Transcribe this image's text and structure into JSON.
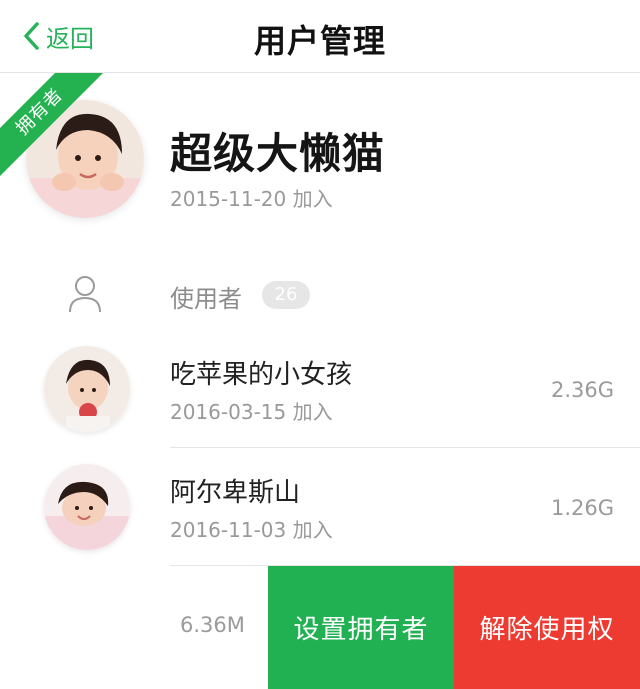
{
  "header": {
    "back_label": "返回",
    "title": "用户管理"
  },
  "owner": {
    "badge": "拥有者",
    "name": "超级大懒猫",
    "joined": "2015-11-20 加入"
  },
  "users_section": {
    "label": "使用者",
    "count": "26"
  },
  "users": [
    {
      "name": "吃苹果的小女孩",
      "joined": "2016-03-15 加入",
      "size": "2.36G"
    },
    {
      "name": "阿尔卑斯山",
      "joined": "2016-11-03 加入",
      "size": "1.26G"
    }
  ],
  "swiped_row": {
    "size": "6.36M",
    "set_owner_label": "设置拥有者",
    "revoke_label": "解除使用权"
  },
  "colors": {
    "accent": "#23b24f",
    "danger": "#ee3b32"
  }
}
